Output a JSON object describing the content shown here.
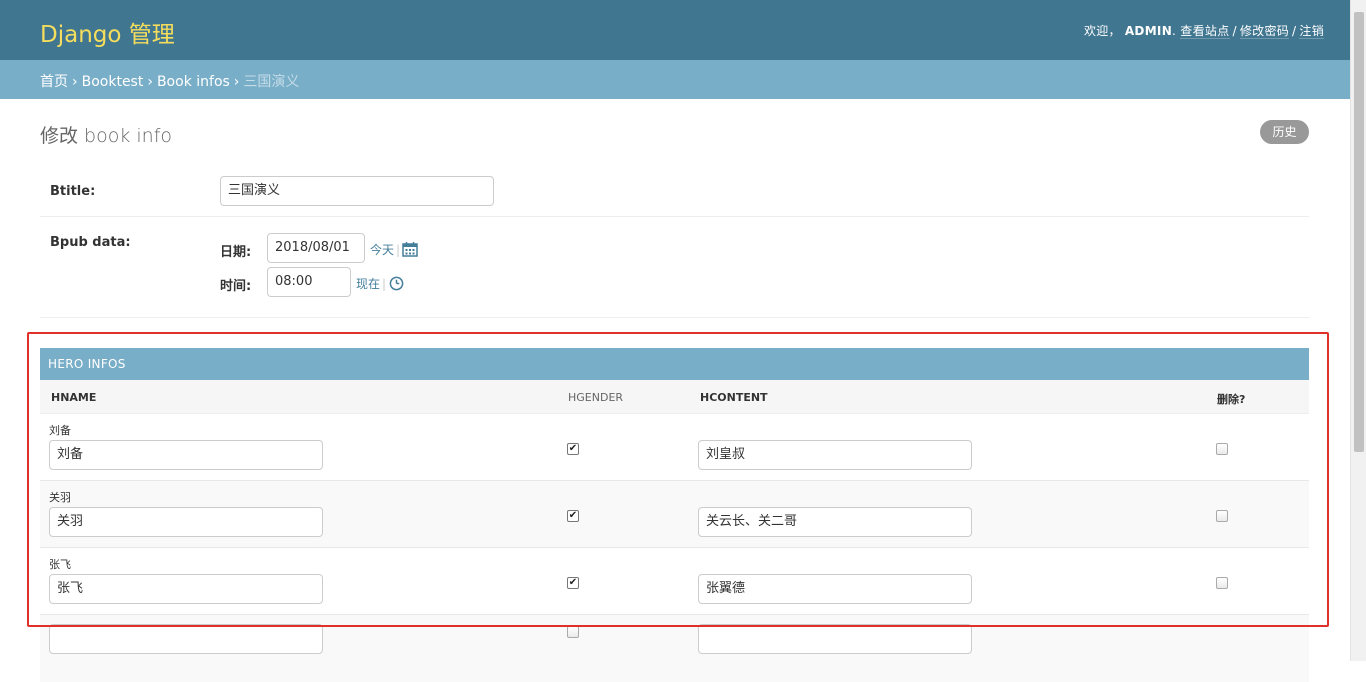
{
  "header": {
    "branding": "Django 管理",
    "welcome": "欢迎，",
    "user": "ADMIN",
    "after_user": ".",
    "links": [
      "查看站点",
      "修改密码",
      "注销"
    ],
    "separator": "/"
  },
  "breadcrumbs": {
    "items": [
      "首页",
      "Booktest",
      "Book infos"
    ],
    "current": "三国演义",
    "arrow": "›"
  },
  "page": {
    "title": "修改 book info",
    "history_label": "历史"
  },
  "form": {
    "btitle": {
      "label": "Btitle:",
      "value": "三国演义"
    },
    "bpub": {
      "label": "Bpub data:",
      "date_label": "日期:",
      "date_value": "2018/08/01",
      "today_label": "今天",
      "time_label": "时间:",
      "time_value": "08:00",
      "now_label": "现在",
      "bar": "|"
    }
  },
  "heroes": {
    "caption": "Hero infos",
    "columns": {
      "name": "HNAME",
      "gender": "HGENDER",
      "content": "HCONTENT",
      "delete": "删除?"
    },
    "rows": [
      {
        "original": "刘备",
        "name": "刘备",
        "gender_checked": true,
        "content": "刘皇叔",
        "delete_checked": false
      },
      {
        "original": "关羽",
        "name": "关羽",
        "gender_checked": true,
        "content": "关云长、关二哥",
        "delete_checked": false
      },
      {
        "original": "张飞",
        "name": "张飞",
        "gender_checked": true,
        "content": "张翼德",
        "delete_checked": false
      },
      {
        "original": "",
        "name": "",
        "gender_checked": false,
        "content": "",
        "delete_checked": false
      }
    ]
  },
  "colors": {
    "header_bg": "#417690",
    "branding": "#f5dd5d",
    "breadcrumbs_bg": "#79aec8",
    "link": "#447e9b",
    "highlight": "#e0302a"
  },
  "icons": {
    "calendar": "calendar-icon",
    "clock": "clock-icon",
    "check": "✔"
  }
}
